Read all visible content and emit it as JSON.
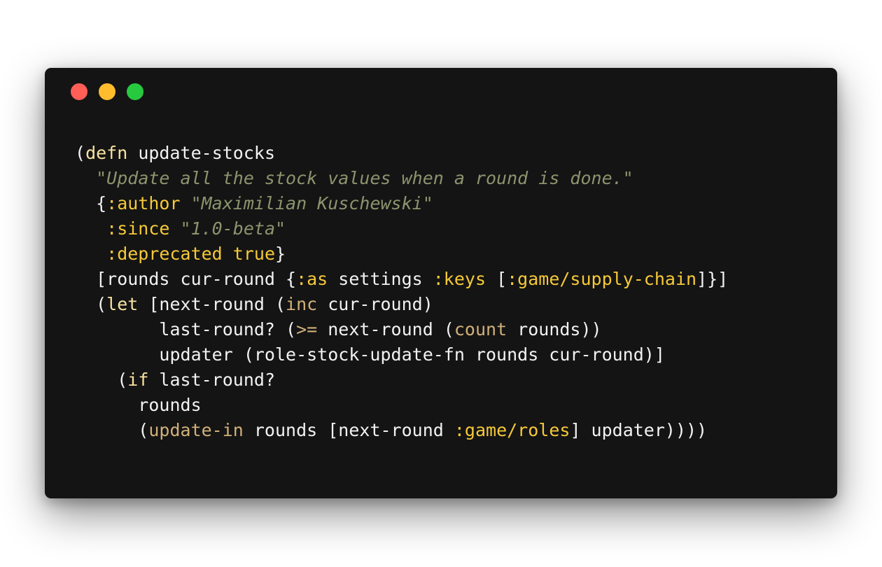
{
  "window": {
    "controls": [
      {
        "name": "close",
        "color": "#ff5f56"
      },
      {
        "name": "minimize",
        "color": "#ffbd2e"
      },
      {
        "name": "maximize",
        "color": "#27c93f"
      }
    ],
    "background": "#141414"
  },
  "colors": {
    "plain": "#f2f2f2",
    "special_form": "#f8e2a0",
    "keyword": "#f6c938",
    "string": "#8c946e",
    "function": "#d1b07a"
  },
  "code": {
    "language": "clojure",
    "lines": [
      [
        {
          "t": "p",
          "s": "("
        },
        {
          "t": "k",
          "s": "defn"
        },
        {
          "t": "p",
          "s": " update-stocks"
        }
      ],
      [
        {
          "t": "p",
          "s": "  "
        },
        {
          "t": "s",
          "s": "\"Update all the stock values when a round is done.\""
        }
      ],
      [
        {
          "t": "p",
          "s": "  {"
        },
        {
          "t": "kw",
          "s": ":author"
        },
        {
          "t": "p",
          "s": " "
        },
        {
          "t": "s",
          "s": "\"Maximilian Kuschewski\""
        }
      ],
      [
        {
          "t": "p",
          "s": "   "
        },
        {
          "t": "kw",
          "s": ":since"
        },
        {
          "t": "p",
          "s": " "
        },
        {
          "t": "s",
          "s": "\"1.0-beta\""
        }
      ],
      [
        {
          "t": "p",
          "s": "   "
        },
        {
          "t": "kw",
          "s": ":deprecated"
        },
        {
          "t": "p",
          "s": " "
        },
        {
          "t": "kw",
          "s": "true"
        },
        {
          "t": "p",
          "s": "}"
        }
      ],
      [
        {
          "t": "p",
          "s": "  [rounds cur-round {"
        },
        {
          "t": "kw",
          "s": ":as"
        },
        {
          "t": "p",
          "s": " settings "
        },
        {
          "t": "kw",
          "s": ":keys"
        },
        {
          "t": "p",
          "s": " ["
        },
        {
          "t": "kw",
          "s": ":game/supply-chain"
        },
        {
          "t": "p",
          "s": "]}]"
        }
      ],
      [
        {
          "t": "p",
          "s": "  ("
        },
        {
          "t": "k",
          "s": "let"
        },
        {
          "t": "p",
          "s": " [next-round ("
        },
        {
          "t": "f",
          "s": "inc"
        },
        {
          "t": "p",
          "s": " cur-round)"
        }
      ],
      [
        {
          "t": "p",
          "s": "        last-round? ("
        },
        {
          "t": "f",
          "s": ">="
        },
        {
          "t": "p",
          "s": " next-round ("
        },
        {
          "t": "f",
          "s": "count"
        },
        {
          "t": "p",
          "s": " rounds))"
        }
      ],
      [
        {
          "t": "p",
          "s": "        updater (role-stock-update-fn rounds cur-round)]"
        }
      ],
      [
        {
          "t": "p",
          "s": "    ("
        },
        {
          "t": "k",
          "s": "if"
        },
        {
          "t": "p",
          "s": " last-round?"
        }
      ],
      [
        {
          "t": "p",
          "s": "      rounds"
        }
      ],
      [
        {
          "t": "p",
          "s": "      ("
        },
        {
          "t": "f",
          "s": "update-in"
        },
        {
          "t": "p",
          "s": " rounds [next-round "
        },
        {
          "t": "kw",
          "s": ":game/roles"
        },
        {
          "t": "p",
          "s": "] updater))))"
        }
      ]
    ]
  }
}
